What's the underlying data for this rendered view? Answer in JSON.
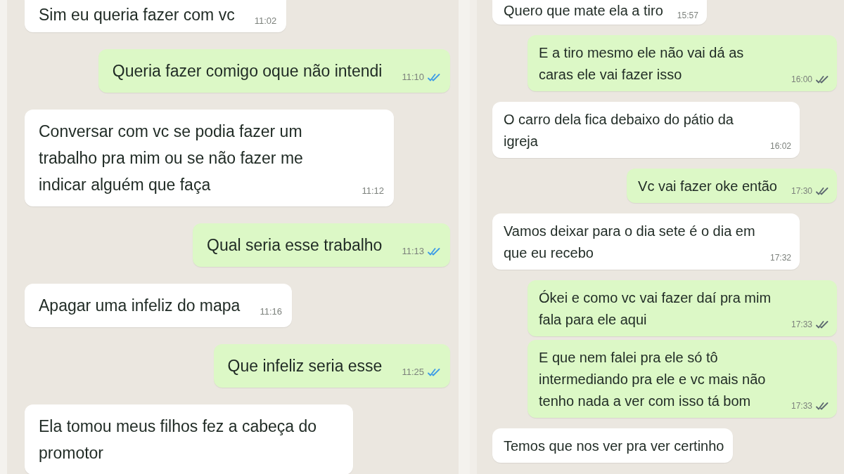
{
  "panels": [
    {
      "messages": [
        {
          "kind": "incoming",
          "text": "Sim eu queria fazer com vc",
          "time": "11:02"
        },
        {
          "kind": "outgoing",
          "text": "Queria fazer comigo oque não intendi",
          "time": "11:10",
          "read": true
        },
        {
          "kind": "incoming",
          "text": "Conversar com vc se podia fazer um trabalho pra mim ou se não fazer me indicar alguém que faça",
          "time": "11:12"
        },
        {
          "kind": "outgoing",
          "text": "Qual seria esse trabalho",
          "time": "11:13",
          "read": true
        },
        {
          "kind": "incoming",
          "text": "Apagar uma infeliz do mapa",
          "time": "11:16"
        },
        {
          "kind": "outgoing",
          "text": "Que infeliz seria esse",
          "time": "11:25",
          "read": true
        },
        {
          "kind": "incoming",
          "text": "Ela tomou meus filhos fez a cabeça do promotor"
        }
      ]
    },
    {
      "messages": [
        {
          "kind": "incoming",
          "text": "Quero que mate ela a tiro",
          "time": "15:57"
        },
        {
          "kind": "outgoing",
          "text": "E a tiro mesmo ele não vai dá as caras ele vai fazer isso",
          "time": "16:00",
          "read": false
        },
        {
          "kind": "incoming",
          "text": "O carro dela fica debaixo do pátio da igreja",
          "time": "16:02"
        },
        {
          "kind": "outgoing",
          "text": "Vc vai fazer oke então",
          "time": "17:30",
          "read": false
        },
        {
          "kind": "incoming",
          "text": "Vamos deixar para o dia sete é o dia em que eu recebo",
          "time": "17:32"
        },
        {
          "kind": "outgoing",
          "text": "Ókei e como vc vai fazer daí pra mim fala para ele aqui",
          "time": "17:33",
          "read": false
        },
        {
          "kind": "outgoing",
          "text": "E que nem falei pra ele só tô intermediando pra ele e vc mais não tenho nada a ver com isso tá bom",
          "time": "17:33",
          "read": false
        },
        {
          "kind": "incoming",
          "text": "Temos que nos ver pra ver certinho"
        }
      ]
    }
  ]
}
